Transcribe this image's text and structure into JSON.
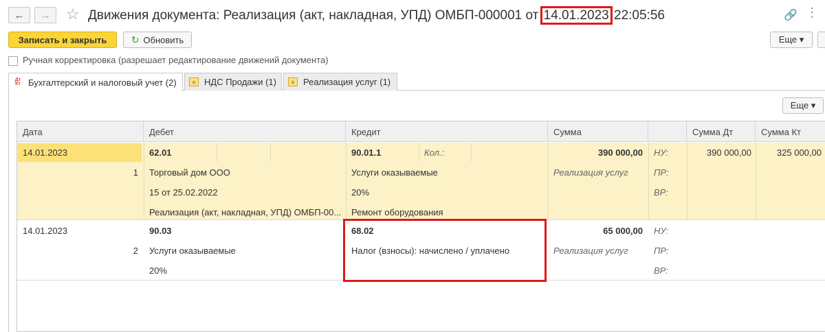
{
  "window": {
    "title_prefix": "Движения документа: Реализация (акт, накладная, УПД) ОМБП-000001 от ",
    "title_date": "14.01.2023",
    "title_time": " 22:05:56"
  },
  "toolbar": {
    "save_close_label": "Записать и закрыть",
    "refresh_label": "Обновить",
    "more_label": "Еще ▾"
  },
  "manual_edit": {
    "label": "Ручная корректировка (разрешает редактирование движений документа)",
    "checked": false
  },
  "tabs": [
    {
      "label": "Бухгалтерский и налоговый учет (2)",
      "icon": "dt-kt-icon",
      "active": true
    },
    {
      "label": "НДС Продажи (1)",
      "icon": "register-icon",
      "active": false
    },
    {
      "label": "Реализация услуг (1)",
      "icon": "register-icon",
      "active": false
    }
  ],
  "grid_more_label": "Еще ▾",
  "table": {
    "headers": {
      "date": "Дата",
      "debit": "Дебет",
      "credit": "Кредит",
      "sum": "Сумма",
      "sum_dt": "Сумма Дт",
      "sum_kt": "Сумма Кт"
    },
    "rows": [
      {
        "date": "14.01.2023",
        "number": "1",
        "debit_account": "62.01",
        "debit_sub": [
          "Торговый дом ООО",
          "15 от 25.02.2022",
          "Реализация (акт, накладная, УПД) ОМБП-00..."
        ],
        "credit_account": "90.01.1",
        "credit_qty_label": "Кол.:",
        "credit_sub": [
          "Услуги оказываемые",
          "20%",
          "Ремонт оборудования"
        ],
        "sum": "390 000,00",
        "content": "Реализация услуг",
        "nu": "НУ:",
        "pr": "ПР:",
        "vr": "ВР:",
        "sum_dt": "390 000,00",
        "sum_kt": "325 000,00"
      },
      {
        "date": "14.01.2023",
        "number": "2",
        "debit_account": "90.03",
        "debit_sub": [
          "Услуги оказываемые",
          "20%"
        ],
        "credit_account": "68.02",
        "credit_sub": [
          "Налог (взносы): начислено / уплачено"
        ],
        "sum": "65 000,00",
        "content": "Реализация услуг",
        "nu": "НУ:",
        "pr": "ПР:",
        "vr": "ВР:"
      }
    ]
  }
}
